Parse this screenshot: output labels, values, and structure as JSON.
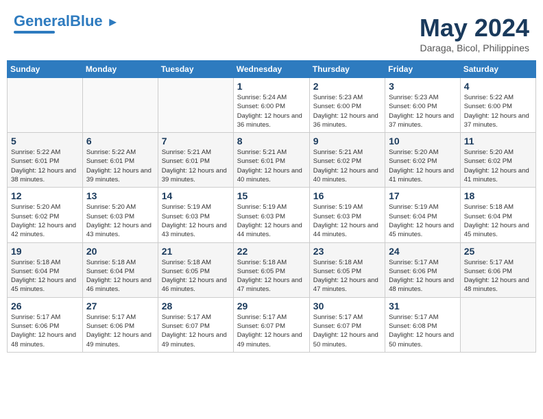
{
  "header": {
    "logo_line1": "General",
    "logo_line2": "Blue",
    "month": "May 2024",
    "location": "Daraga, Bicol, Philippines"
  },
  "weekdays": [
    "Sunday",
    "Monday",
    "Tuesday",
    "Wednesday",
    "Thursday",
    "Friday",
    "Saturday"
  ],
  "weeks": [
    [
      {
        "day": "",
        "info": ""
      },
      {
        "day": "",
        "info": ""
      },
      {
        "day": "",
        "info": ""
      },
      {
        "day": "1",
        "info": "Sunrise: 5:24 AM\nSunset: 6:00 PM\nDaylight: 12 hours\nand 36 minutes."
      },
      {
        "day": "2",
        "info": "Sunrise: 5:23 AM\nSunset: 6:00 PM\nDaylight: 12 hours\nand 36 minutes."
      },
      {
        "day": "3",
        "info": "Sunrise: 5:23 AM\nSunset: 6:00 PM\nDaylight: 12 hours\nand 37 minutes."
      },
      {
        "day": "4",
        "info": "Sunrise: 5:22 AM\nSunset: 6:00 PM\nDaylight: 12 hours\nand 37 minutes."
      }
    ],
    [
      {
        "day": "5",
        "info": "Sunrise: 5:22 AM\nSunset: 6:01 PM\nDaylight: 12 hours\nand 38 minutes."
      },
      {
        "day": "6",
        "info": "Sunrise: 5:22 AM\nSunset: 6:01 PM\nDaylight: 12 hours\nand 39 minutes."
      },
      {
        "day": "7",
        "info": "Sunrise: 5:21 AM\nSunset: 6:01 PM\nDaylight: 12 hours\nand 39 minutes."
      },
      {
        "day": "8",
        "info": "Sunrise: 5:21 AM\nSunset: 6:01 PM\nDaylight: 12 hours\nand 40 minutes."
      },
      {
        "day": "9",
        "info": "Sunrise: 5:21 AM\nSunset: 6:02 PM\nDaylight: 12 hours\nand 40 minutes."
      },
      {
        "day": "10",
        "info": "Sunrise: 5:20 AM\nSunset: 6:02 PM\nDaylight: 12 hours\nand 41 minutes."
      },
      {
        "day": "11",
        "info": "Sunrise: 5:20 AM\nSunset: 6:02 PM\nDaylight: 12 hours\nand 41 minutes."
      }
    ],
    [
      {
        "day": "12",
        "info": "Sunrise: 5:20 AM\nSunset: 6:02 PM\nDaylight: 12 hours\nand 42 minutes."
      },
      {
        "day": "13",
        "info": "Sunrise: 5:20 AM\nSunset: 6:03 PM\nDaylight: 12 hours\nand 43 minutes."
      },
      {
        "day": "14",
        "info": "Sunrise: 5:19 AM\nSunset: 6:03 PM\nDaylight: 12 hours\nand 43 minutes."
      },
      {
        "day": "15",
        "info": "Sunrise: 5:19 AM\nSunset: 6:03 PM\nDaylight: 12 hours\nand 44 minutes."
      },
      {
        "day": "16",
        "info": "Sunrise: 5:19 AM\nSunset: 6:03 PM\nDaylight: 12 hours\nand 44 minutes."
      },
      {
        "day": "17",
        "info": "Sunrise: 5:19 AM\nSunset: 6:04 PM\nDaylight: 12 hours\nand 45 minutes."
      },
      {
        "day": "18",
        "info": "Sunrise: 5:18 AM\nSunset: 6:04 PM\nDaylight: 12 hours\nand 45 minutes."
      }
    ],
    [
      {
        "day": "19",
        "info": "Sunrise: 5:18 AM\nSunset: 6:04 PM\nDaylight: 12 hours\nand 45 minutes."
      },
      {
        "day": "20",
        "info": "Sunrise: 5:18 AM\nSunset: 6:04 PM\nDaylight: 12 hours\nand 46 minutes."
      },
      {
        "day": "21",
        "info": "Sunrise: 5:18 AM\nSunset: 6:05 PM\nDaylight: 12 hours\nand 46 minutes."
      },
      {
        "day": "22",
        "info": "Sunrise: 5:18 AM\nSunset: 6:05 PM\nDaylight: 12 hours\nand 47 minutes."
      },
      {
        "day": "23",
        "info": "Sunrise: 5:18 AM\nSunset: 6:05 PM\nDaylight: 12 hours\nand 47 minutes."
      },
      {
        "day": "24",
        "info": "Sunrise: 5:17 AM\nSunset: 6:06 PM\nDaylight: 12 hours\nand 48 minutes."
      },
      {
        "day": "25",
        "info": "Sunrise: 5:17 AM\nSunset: 6:06 PM\nDaylight: 12 hours\nand 48 minutes."
      }
    ],
    [
      {
        "day": "26",
        "info": "Sunrise: 5:17 AM\nSunset: 6:06 PM\nDaylight: 12 hours\nand 48 minutes."
      },
      {
        "day": "27",
        "info": "Sunrise: 5:17 AM\nSunset: 6:06 PM\nDaylight: 12 hours\nand 49 minutes."
      },
      {
        "day": "28",
        "info": "Sunrise: 5:17 AM\nSunset: 6:07 PM\nDaylight: 12 hours\nand 49 minutes."
      },
      {
        "day": "29",
        "info": "Sunrise: 5:17 AM\nSunset: 6:07 PM\nDaylight: 12 hours\nand 49 minutes."
      },
      {
        "day": "30",
        "info": "Sunrise: 5:17 AM\nSunset: 6:07 PM\nDaylight: 12 hours\nand 50 minutes."
      },
      {
        "day": "31",
        "info": "Sunrise: 5:17 AM\nSunset: 6:08 PM\nDaylight: 12 hours\nand 50 minutes."
      },
      {
        "day": "",
        "info": ""
      }
    ]
  ]
}
